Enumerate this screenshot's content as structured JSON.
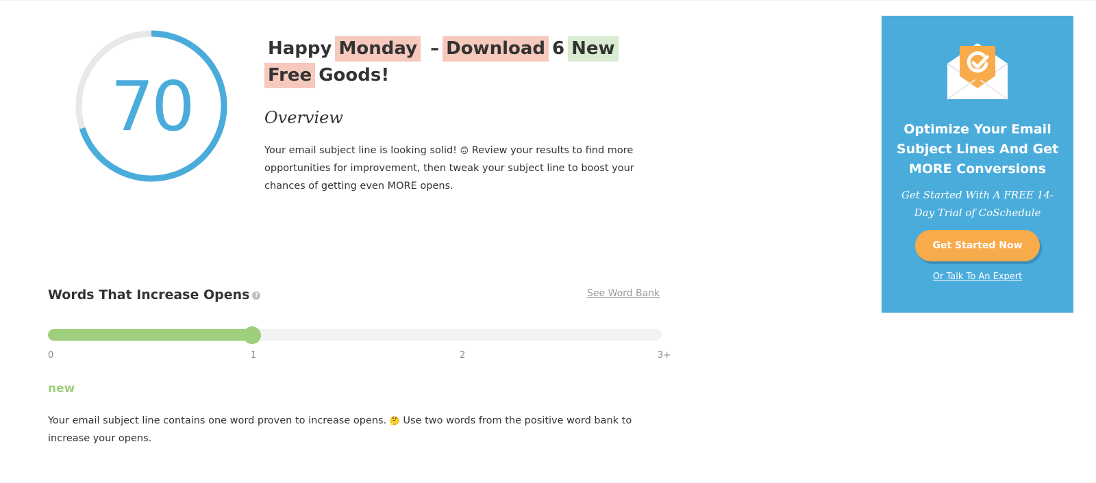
{
  "score": {
    "value": "70",
    "fraction": 0.7,
    "color": "#4aacdb",
    "track_color": "#e8e8e8"
  },
  "headline": {
    "tokens": [
      {
        "text": "Happy",
        "highlight": "none"
      },
      {
        "text": "Monday",
        "highlight": "red"
      },
      {
        "text": "–",
        "highlight": "none"
      },
      {
        "text": "Download",
        "highlight": "red"
      },
      {
        "text": "6",
        "highlight": "none"
      },
      {
        "text": "New",
        "highlight": "green"
      },
      {
        "text": "Free",
        "highlight": "red"
      },
      {
        "text": "Goods!",
        "highlight": "none"
      }
    ]
  },
  "overview": {
    "heading": "Overview",
    "text_before": "Your email subject line is looking solid!",
    "emoji": "🙃",
    "text_after": "Review your results to find more opportunities for improvement, then tweak your subject line to boost your chances of getting even MORE opens."
  },
  "words_section": {
    "title": "Words That Increase Opens",
    "help_icon": "question-circle-icon",
    "word_bank_link": "See Word Bank",
    "slider": {
      "value": 1,
      "max": 3,
      "ticks": [
        "0",
        "1",
        "2",
        "3+"
      ],
      "color": "#9fce7d"
    },
    "found_word": "new",
    "result_before": "Your email subject line contains one word proven to increase opens.",
    "emoji": "🤔",
    "result_after": "Use two words from the positive word bank to increase your opens."
  },
  "ad": {
    "icon": "envelope-check-icon",
    "headline": "Optimize Your Email Subject Lines And Get MORE Conversions",
    "subheadline": "Get Started With A FREE 14-Day Trial of CoSchedule",
    "button_label": "Get Started Now",
    "link_label": "Or Talk To An Expert",
    "background": "#4aacdb",
    "button_color": "#f8ab4a"
  }
}
